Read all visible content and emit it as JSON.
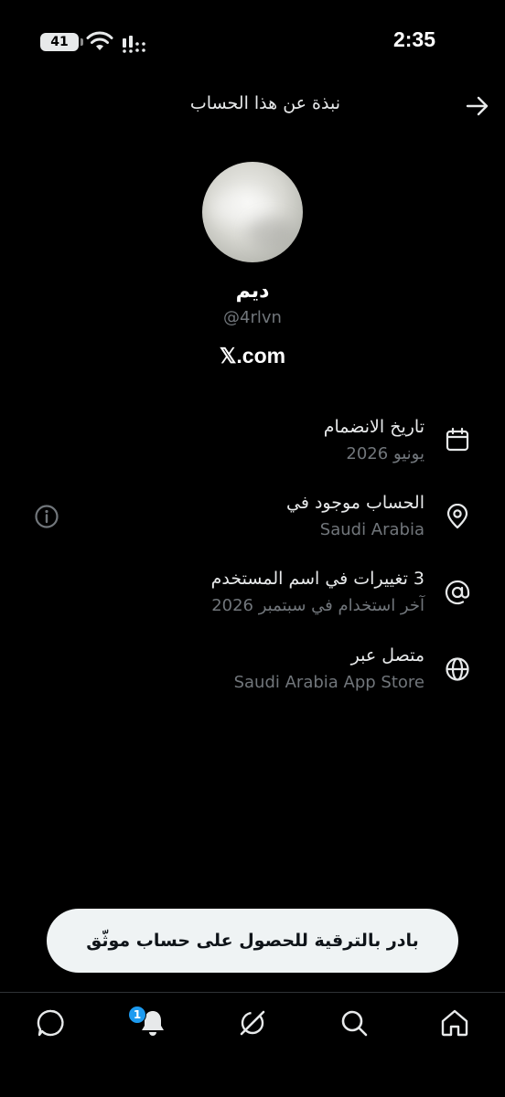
{
  "status_bar": {
    "time": "2:35",
    "battery": "41"
  },
  "header": {
    "title": "نبذة عن هذا الحساب"
  },
  "profile": {
    "display_name": "ديم",
    "handle": "@4rlvn",
    "site": "𝕏.com"
  },
  "rows": [
    {
      "icon": "calendar-icon",
      "title": "تاريخ الانضمام",
      "subtitle": "يونيو 2026"
    },
    {
      "icon": "location-pin-icon",
      "title": "الحساب موجود في",
      "subtitle": "Saudi Arabia"
    },
    {
      "icon": "at-sign-icon",
      "title": "3 تغييرات في اسم المستخدم",
      "subtitle": "آخر استخدام في سبتمبر 2026"
    },
    {
      "icon": "globe-icon",
      "title": "متصل عبر",
      "subtitle": "Saudi Arabia App Store"
    }
  ],
  "upgrade": {
    "label": "بادر بالترقية للحصول على حساب موثّق"
  },
  "nav": {
    "notifications_badge": "1",
    "accent": "#1d9bf0"
  }
}
